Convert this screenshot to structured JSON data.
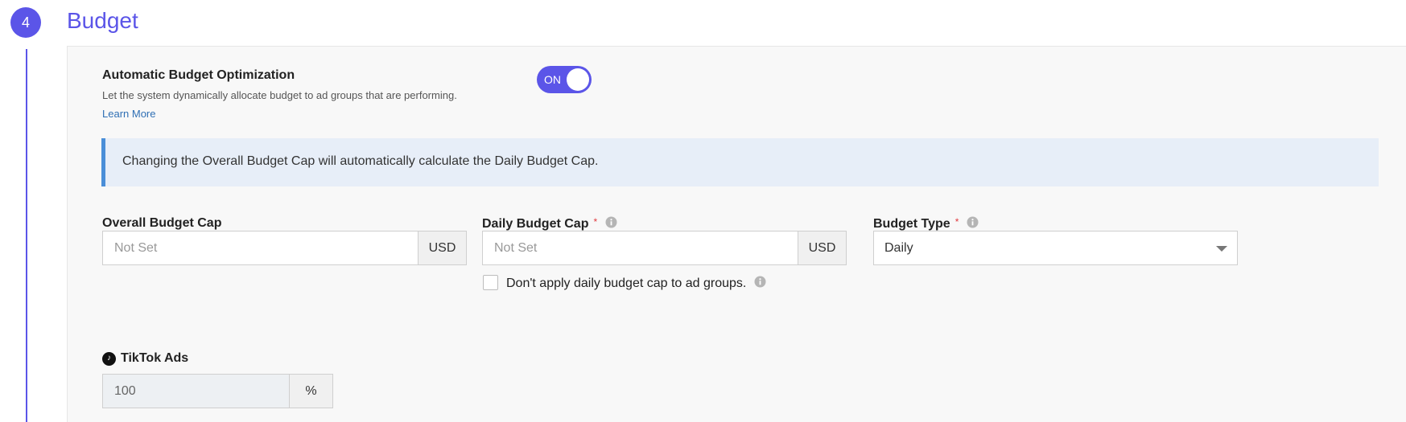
{
  "step": {
    "number": "4",
    "title": "Budget"
  },
  "abo": {
    "title": "Automatic Budget Optimization",
    "description": "Let the system dynamically allocate budget to ad groups that are performing.",
    "learn_more": "Learn More",
    "toggle_label": "ON",
    "toggle_state": "on"
  },
  "banner": {
    "text": "Changing the Overall Budget Cap will automatically calculate the Daily Budget Cap."
  },
  "fields": {
    "overall": {
      "label": "Overall Budget Cap",
      "placeholder": "Not Set",
      "unit": "USD"
    },
    "daily": {
      "label": "Daily Budget Cap",
      "required_mark": "*",
      "placeholder": "Not Set",
      "unit": "USD"
    },
    "type": {
      "label": "Budget Type",
      "required_mark": "*",
      "value": "Daily"
    }
  },
  "checkbox": {
    "label": "Don't apply daily budget cap to ad groups.",
    "checked": false
  },
  "platform": {
    "name": "TikTok Ads",
    "value": "100",
    "unit": "%"
  },
  "colors": {
    "accent": "#5b55e8",
    "link": "#2f6fb4",
    "banner_bg": "#e7eef8",
    "banner_border": "#4a8ed8",
    "required": "#e0393e"
  }
}
